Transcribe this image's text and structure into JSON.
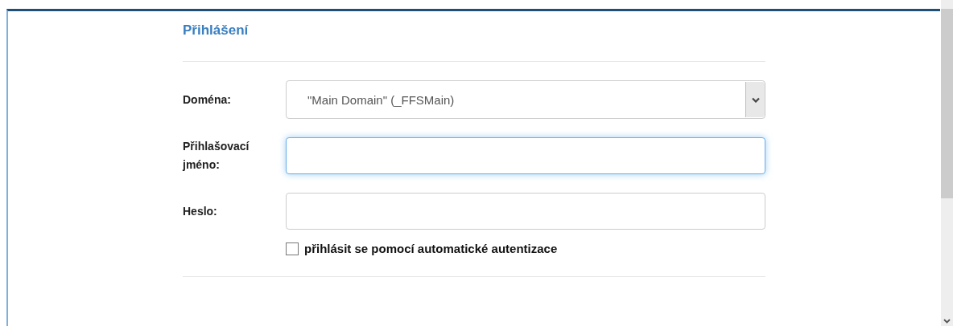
{
  "heading": "Přihlášení",
  "fields": [
    {
      "kind": "select",
      "label": "Doména:",
      "value": "\"Main Domain\" (_FFSMain)",
      "focused": false
    },
    {
      "kind": "text",
      "label": "Přihlašovací jméno:",
      "focused": true
    },
    {
      "kind": "password",
      "label": "Heslo:",
      "focused": false
    }
  ],
  "auto_auth": {
    "label": "přihlásit se pomocí automatické autentizace",
    "checked": false
  }
}
